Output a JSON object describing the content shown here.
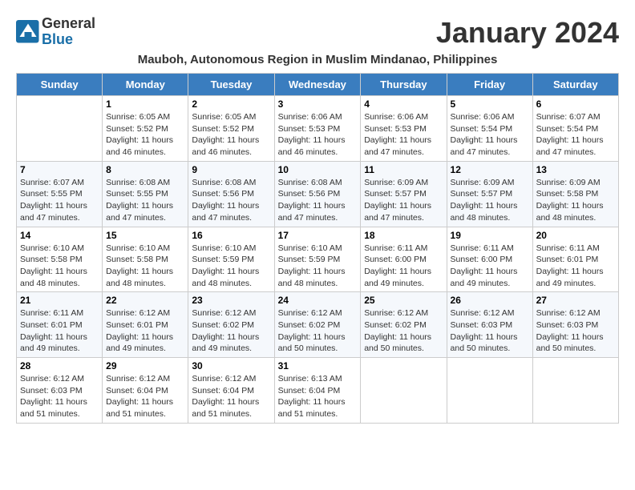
{
  "logo": {
    "general": "General",
    "blue": "Blue"
  },
  "title": "January 2024",
  "subtitle": "Mauboh, Autonomous Region in Muslim Mindanao, Philippines",
  "days_of_week": [
    "Sunday",
    "Monday",
    "Tuesday",
    "Wednesday",
    "Thursday",
    "Friday",
    "Saturday"
  ],
  "weeks": [
    [
      {
        "day": "",
        "info": ""
      },
      {
        "day": "1",
        "info": "Sunrise: 6:05 AM\nSunset: 5:52 PM\nDaylight: 11 hours\nand 46 minutes."
      },
      {
        "day": "2",
        "info": "Sunrise: 6:05 AM\nSunset: 5:52 PM\nDaylight: 11 hours\nand 46 minutes."
      },
      {
        "day": "3",
        "info": "Sunrise: 6:06 AM\nSunset: 5:53 PM\nDaylight: 11 hours\nand 46 minutes."
      },
      {
        "day": "4",
        "info": "Sunrise: 6:06 AM\nSunset: 5:53 PM\nDaylight: 11 hours\nand 47 minutes."
      },
      {
        "day": "5",
        "info": "Sunrise: 6:06 AM\nSunset: 5:54 PM\nDaylight: 11 hours\nand 47 minutes."
      },
      {
        "day": "6",
        "info": "Sunrise: 6:07 AM\nSunset: 5:54 PM\nDaylight: 11 hours\nand 47 minutes."
      }
    ],
    [
      {
        "day": "7",
        "info": "Sunrise: 6:07 AM\nSunset: 5:55 PM\nDaylight: 11 hours\nand 47 minutes."
      },
      {
        "day": "8",
        "info": "Sunrise: 6:08 AM\nSunset: 5:55 PM\nDaylight: 11 hours\nand 47 minutes."
      },
      {
        "day": "9",
        "info": "Sunrise: 6:08 AM\nSunset: 5:56 PM\nDaylight: 11 hours\nand 47 minutes."
      },
      {
        "day": "10",
        "info": "Sunrise: 6:08 AM\nSunset: 5:56 PM\nDaylight: 11 hours\nand 47 minutes."
      },
      {
        "day": "11",
        "info": "Sunrise: 6:09 AM\nSunset: 5:57 PM\nDaylight: 11 hours\nand 47 minutes."
      },
      {
        "day": "12",
        "info": "Sunrise: 6:09 AM\nSunset: 5:57 PM\nDaylight: 11 hours\nand 48 minutes."
      },
      {
        "day": "13",
        "info": "Sunrise: 6:09 AM\nSunset: 5:58 PM\nDaylight: 11 hours\nand 48 minutes."
      }
    ],
    [
      {
        "day": "14",
        "info": "Sunrise: 6:10 AM\nSunset: 5:58 PM\nDaylight: 11 hours\nand 48 minutes."
      },
      {
        "day": "15",
        "info": "Sunrise: 6:10 AM\nSunset: 5:58 PM\nDaylight: 11 hours\nand 48 minutes."
      },
      {
        "day": "16",
        "info": "Sunrise: 6:10 AM\nSunset: 5:59 PM\nDaylight: 11 hours\nand 48 minutes."
      },
      {
        "day": "17",
        "info": "Sunrise: 6:10 AM\nSunset: 5:59 PM\nDaylight: 11 hours\nand 48 minutes."
      },
      {
        "day": "18",
        "info": "Sunrise: 6:11 AM\nSunset: 6:00 PM\nDaylight: 11 hours\nand 49 minutes."
      },
      {
        "day": "19",
        "info": "Sunrise: 6:11 AM\nSunset: 6:00 PM\nDaylight: 11 hours\nand 49 minutes."
      },
      {
        "day": "20",
        "info": "Sunrise: 6:11 AM\nSunset: 6:01 PM\nDaylight: 11 hours\nand 49 minutes."
      }
    ],
    [
      {
        "day": "21",
        "info": "Sunrise: 6:11 AM\nSunset: 6:01 PM\nDaylight: 11 hours\nand 49 minutes."
      },
      {
        "day": "22",
        "info": "Sunrise: 6:12 AM\nSunset: 6:01 PM\nDaylight: 11 hours\nand 49 minutes."
      },
      {
        "day": "23",
        "info": "Sunrise: 6:12 AM\nSunset: 6:02 PM\nDaylight: 11 hours\nand 49 minutes."
      },
      {
        "day": "24",
        "info": "Sunrise: 6:12 AM\nSunset: 6:02 PM\nDaylight: 11 hours\nand 50 minutes."
      },
      {
        "day": "25",
        "info": "Sunrise: 6:12 AM\nSunset: 6:02 PM\nDaylight: 11 hours\nand 50 minutes."
      },
      {
        "day": "26",
        "info": "Sunrise: 6:12 AM\nSunset: 6:03 PM\nDaylight: 11 hours\nand 50 minutes."
      },
      {
        "day": "27",
        "info": "Sunrise: 6:12 AM\nSunset: 6:03 PM\nDaylight: 11 hours\nand 50 minutes."
      }
    ],
    [
      {
        "day": "28",
        "info": "Sunrise: 6:12 AM\nSunset: 6:03 PM\nDaylight: 11 hours\nand 51 minutes."
      },
      {
        "day": "29",
        "info": "Sunrise: 6:12 AM\nSunset: 6:04 PM\nDaylight: 11 hours\nand 51 minutes."
      },
      {
        "day": "30",
        "info": "Sunrise: 6:12 AM\nSunset: 6:04 PM\nDaylight: 11 hours\nand 51 minutes."
      },
      {
        "day": "31",
        "info": "Sunrise: 6:13 AM\nSunset: 6:04 PM\nDaylight: 11 hours\nand 51 minutes."
      },
      {
        "day": "",
        "info": ""
      },
      {
        "day": "",
        "info": ""
      },
      {
        "day": "",
        "info": ""
      }
    ]
  ]
}
